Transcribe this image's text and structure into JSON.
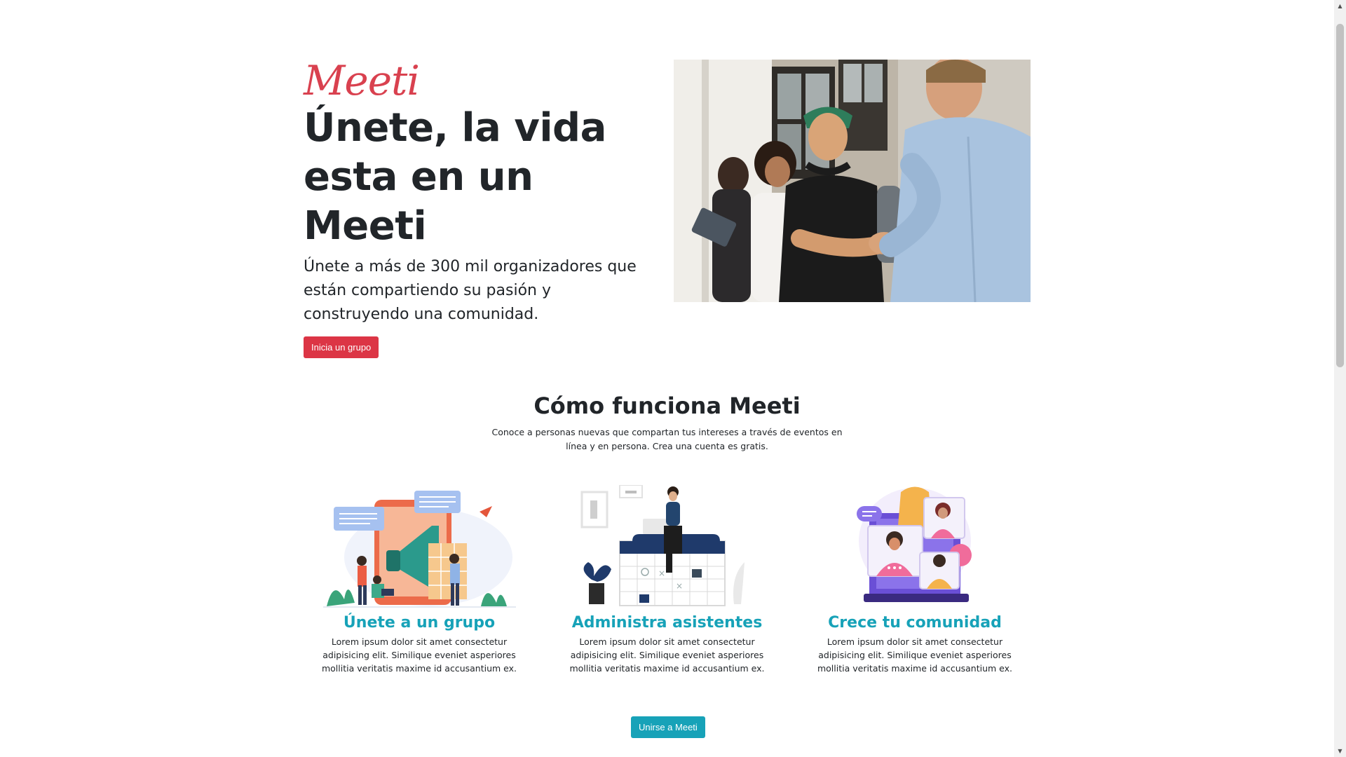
{
  "hero": {
    "brand": "Meeti",
    "title": "Únete, la vida esta en un Meeti",
    "lead": "Únete a más de 300 mil organizadores que están compartiendo su pasión y construyendo una comunidad.",
    "cta_label": "Inicia un grupo"
  },
  "how": {
    "title": "Cómo funciona Meeti",
    "subtitle": "Conoce a personas nuevas que compartan tus intereses a través de eventos en línea y en persona. Crea una cuenta es gratis."
  },
  "features": [
    {
      "title": "Únete a un grupo",
      "text": "Lorem ipsum dolor sit amet consectetur adipisicing elit. Similique eveniet asperiores mollitia veritatis maxime id accusantium ex.",
      "illustration": "megaphone-illustration"
    },
    {
      "title": "Administra asistentes",
      "text": "Lorem ipsum dolor sit amet consectetur adipisicing elit. Similique eveniet asperiores mollitia veritatis maxime id accusantium ex.",
      "illustration": "calendar-illustration"
    },
    {
      "title": "Crece tu comunidad",
      "text": "Lorem ipsum dolor sit amet consectetur adipisicing elit. Similique eveniet asperiores mollitia veritatis maxime id accusantium ex.",
      "illustration": "video-call-illustration"
    }
  ],
  "join_label": "Unirse a Meeti",
  "colors": {
    "brand_red": "#dc3545",
    "brand_logo": "#d9414f",
    "accent_teal": "#17a2b8",
    "text": "#212529"
  }
}
